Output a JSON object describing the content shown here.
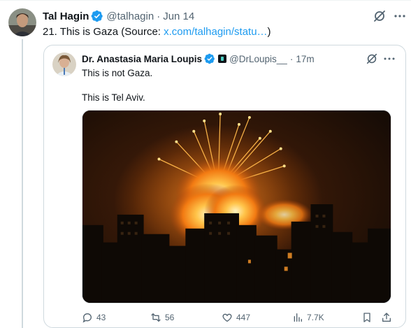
{
  "tweet": {
    "author_name": "Tal Hagin",
    "handle": "@talhagin",
    "separator": "·",
    "date": "Jun 14",
    "text_prefix": "21. This is Gaza (Source: ",
    "link_text": "x.com/talhagin/statu…",
    "text_suffix": ")",
    "icons": [
      "verified-badge-icon",
      "grok-icon",
      "more-icon"
    ]
  },
  "quote": {
    "author_name": "Dr. Anastasia Maria Loupis",
    "handle": "@DrLoupis__",
    "separator": "·",
    "time": "17m",
    "line1": "This is not Gaza.",
    "line2": "This is Tel Aviv.",
    "media_description": "night cityscape with large orange explosion",
    "stats": {
      "replies": "43",
      "reposts": "56",
      "likes": "447",
      "views": "7.7K"
    }
  },
  "colors": {
    "accent": "#1d9bf0",
    "text": "#0f1419",
    "secondary": "#536471",
    "border": "#cfd9de",
    "repost_green": "#00ba7c"
  }
}
